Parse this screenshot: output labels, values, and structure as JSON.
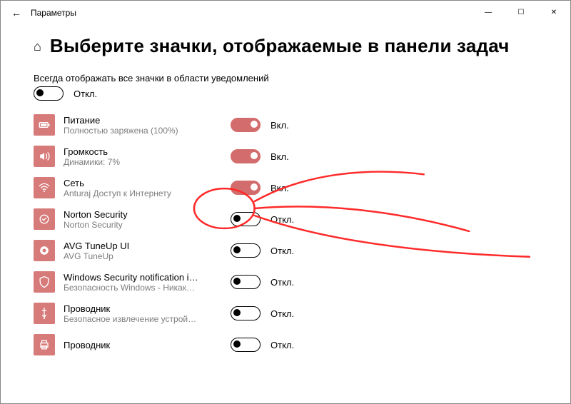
{
  "window": {
    "back_glyph": "←",
    "title": "Параметры",
    "min_glyph": "—",
    "max_glyph": "☐",
    "close_glyph": "✕"
  },
  "page": {
    "home_glyph": "⌂",
    "heading": "Выберите значки, отображаемые в панели задач",
    "always_show_link": "Всегда отображать все значки в области уведомлений",
    "master_state": false,
    "off_label": "Откл.",
    "on_label": "Вкл."
  },
  "items": [
    {
      "icon": "battery",
      "title": "Питание",
      "subtitle": "Полностью заряжена (100%)",
      "on": true
    },
    {
      "icon": "volume",
      "title": "Громкость",
      "subtitle": "Динамики: 7%",
      "on": true
    },
    {
      "icon": "wifi",
      "title": "Сеть",
      "subtitle": "Anturaj Доступ к Интернету",
      "on": true
    },
    {
      "icon": "norton",
      "title": "Norton Security",
      "subtitle": "Norton Security",
      "on": false
    },
    {
      "icon": "avg",
      "title": "AVG TuneUp UI",
      "subtitle": "AVG TuneUp",
      "on": false
    },
    {
      "icon": "shield",
      "title": "Windows Security notification icon",
      "subtitle": "Безопасность Windows - Никаких...",
      "on": false
    },
    {
      "icon": "usb",
      "title": "Проводник",
      "subtitle": "Безопасное извлечение устройств...",
      "on": false
    },
    {
      "icon": "print",
      "title": "Проводник",
      "subtitle": "",
      "on": false
    }
  ],
  "colors": {
    "accent": "#d77a7a",
    "annotation": "#ff2a2a"
  }
}
